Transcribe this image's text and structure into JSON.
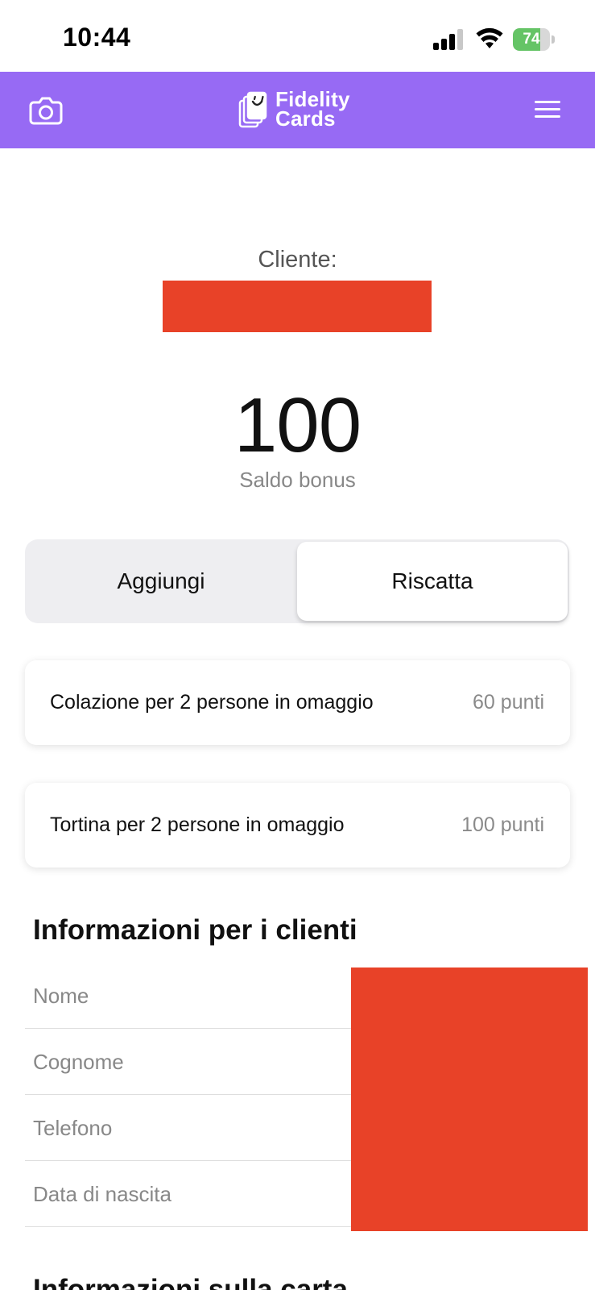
{
  "status_bar": {
    "time": "10:44",
    "battery_percent": 74,
    "battery_label": "74"
  },
  "header": {
    "logo_line1": "Fidelity",
    "logo_line2": "Cards",
    "accent_color": "#976af4",
    "left_icon": "camera-icon",
    "right_icon": "hamburger-menu-icon"
  },
  "customer": {
    "label": "Cliente:"
  },
  "bonus": {
    "value": "100",
    "label": "Saldo bonus"
  },
  "tabs": [
    {
      "label": "Aggiungi",
      "selected": false
    },
    {
      "label": "Riscatta",
      "selected": true
    }
  ],
  "rewards": [
    {
      "title": "Colazione per 2 persone in omaggio",
      "points": "60 punti"
    },
    {
      "title": "Tortina per 2 persone in omaggio",
      "points": "100 punti"
    }
  ],
  "customer_info": {
    "title": "Informazioni per i clienti",
    "fields": [
      {
        "label": "Nome"
      },
      {
        "label": "Cognome"
      },
      {
        "label": "Telefono"
      },
      {
        "label": "Data di nascita"
      }
    ]
  },
  "card_info": {
    "title": "Informazioni sulla carta"
  },
  "redaction_color": "#e84228"
}
